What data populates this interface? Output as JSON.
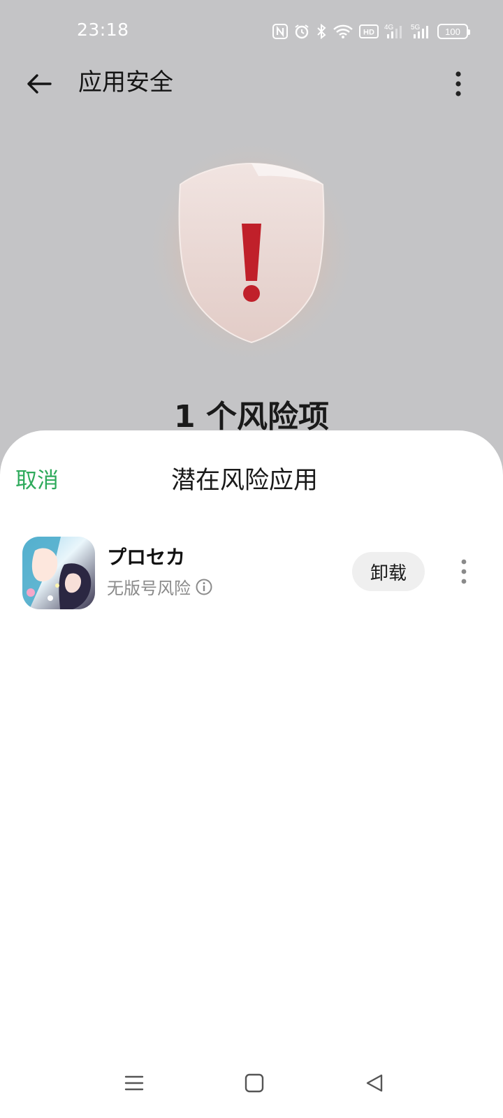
{
  "status_bar": {
    "time": "23:18",
    "icons": [
      "nfc-icon",
      "alarm-icon",
      "bluetooth-icon",
      "wifi-icon",
      "hd-icon",
      "signal-4g-icon",
      "signal-5g-icon"
    ],
    "battery": "100"
  },
  "app_bar": {
    "title": "应用安全",
    "back_icon": "arrow-left-icon",
    "more_icon": "more-vertical-icon"
  },
  "hero": {
    "risk_count_text": "1 个风险项",
    "shield_icon": "shield-warning-icon"
  },
  "sheet": {
    "cancel_label": "取消",
    "title": "潜在风险应用",
    "apps": [
      {
        "name": "プロセカ",
        "risk": "无版号风险",
        "uninstall_label": "卸载"
      }
    ]
  },
  "colors": {
    "accent": "#2eaa5b",
    "warning": "#c0202a",
    "scrim": "#c4c4c6"
  }
}
